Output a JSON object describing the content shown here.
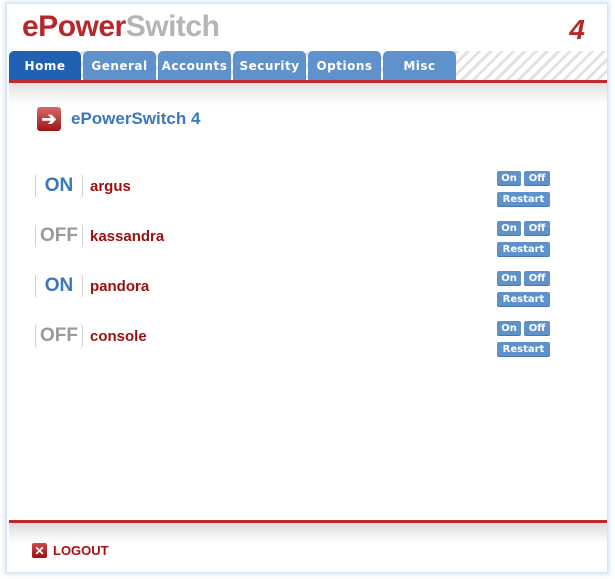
{
  "header": {
    "brand_part1": "ePower",
    "brand_part2": "Switch",
    "version": "4"
  },
  "tabs": [
    {
      "label": "Home",
      "active": true
    },
    {
      "label": "General",
      "active": false
    },
    {
      "label": "Accounts",
      "active": false
    },
    {
      "label": "Security",
      "active": false
    },
    {
      "label": "Options",
      "active": false
    },
    {
      "label": "Misc",
      "active": false
    }
  ],
  "colors": {
    "accent_red": "#c1272d",
    "tab_blue": "#5f92cc",
    "tab_active_blue": "#2161b3",
    "on_blue": "#3a78bd",
    "off_gray": "#9a9a9a",
    "name_red": "#9b0f0f"
  },
  "main": {
    "heading_icon": "arrow-right-icon",
    "heading": "ePowerSwitch 4",
    "outlets": [
      {
        "state": "ON",
        "name": "argus"
      },
      {
        "state": "OFF",
        "name": "kassandra"
      },
      {
        "state": "ON",
        "name": "pandora"
      },
      {
        "state": "OFF",
        "name": "console"
      }
    ],
    "buttons": {
      "on": "On",
      "off": "Off",
      "restart": "Restart"
    }
  },
  "footer": {
    "logout_icon": "close-icon",
    "logout_label": "LOGOUT"
  }
}
